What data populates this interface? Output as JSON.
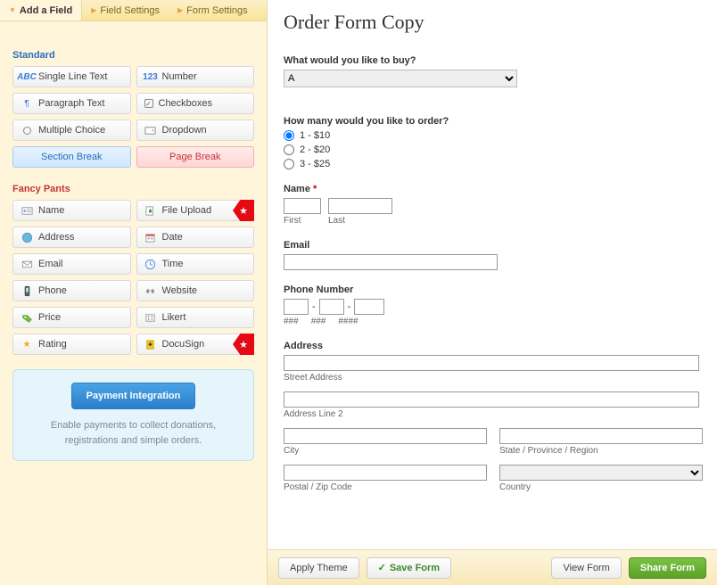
{
  "tabs": {
    "add": "Add a Field",
    "field_settings": "Field Settings",
    "form_settings": "Form Settings"
  },
  "sections": {
    "standard": "Standard",
    "fancy": "Fancy Pants"
  },
  "std_fields": {
    "single_line": "Single Line Text",
    "number": "Number",
    "paragraph": "Paragraph Text",
    "checkboxes": "Checkboxes",
    "multiple_choice": "Multiple Choice",
    "dropdown": "Dropdown",
    "section_break": "Section Break",
    "page_break": "Page Break"
  },
  "fancy_fields": {
    "name": "Name",
    "file_upload": "File Upload",
    "address": "Address",
    "date": "Date",
    "email": "Email",
    "time": "Time",
    "phone": "Phone",
    "website": "Website",
    "price": "Price",
    "likert": "Likert",
    "rating": "Rating",
    "docusign": "DocuSign"
  },
  "promo": {
    "button": "Payment Integration",
    "text": "Enable payments to collect donations, registrations and simple orders."
  },
  "form": {
    "title": "Order Form Copy",
    "q1_label": "What would you like to buy?",
    "q1_value": "A",
    "q2_label": "How many would you like to order?",
    "q2_opt1": "1 - $10",
    "q2_opt2": "2 - $20",
    "q2_opt3": "3 - $25",
    "name_label": "Name",
    "first_sub": "First",
    "last_sub": "Last",
    "email_label": "Email",
    "phone_label": "Phone Number",
    "phone_h3a": "###",
    "phone_h3b": "###",
    "phone_h4": "####",
    "address_label": "Address",
    "street_sub": "Street Address",
    "line2_sub": "Address Line 2",
    "city_sub": "City",
    "state_sub": "State / Province / Region",
    "postal_sub": "Postal / Zip Code",
    "country_sub": "Country"
  },
  "footer": {
    "apply_theme": "Apply Theme",
    "save_form": "Save Form",
    "view_form": "View Form",
    "share_form": "Share Form"
  }
}
